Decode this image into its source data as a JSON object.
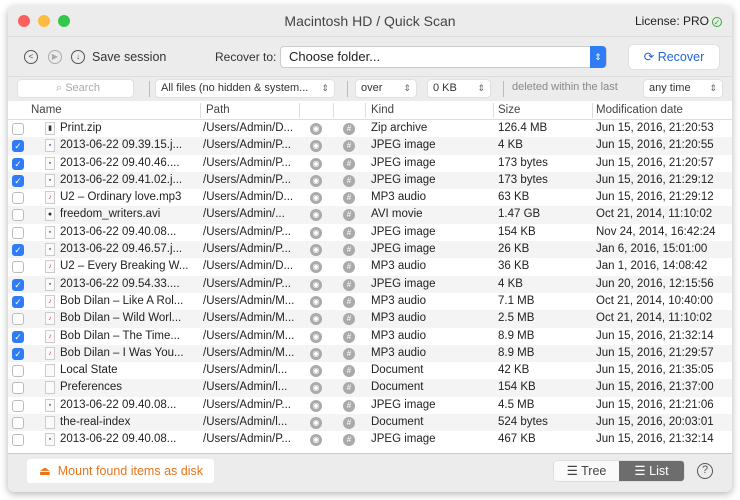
{
  "window": {
    "title": "Macintosh HD / Quick Scan",
    "license": "License: PRO",
    "traffic_colors": [
      "#fc605c",
      "#fdbc40",
      "#34c84a"
    ]
  },
  "toolbar": {
    "save_session": "Save session",
    "recover_to_label": "Recover to:",
    "recover_to_value": "Choose folder...",
    "recover_button": "Recover"
  },
  "filter": {
    "search_placeholder": "Search",
    "file_type": "All files (no hidden & system...",
    "size_op": "over",
    "size_value": "0 KB",
    "deleted_label": "deleted within the last",
    "time": "any time"
  },
  "columns": {
    "name": "Name",
    "path": "Path",
    "kind": "Kind",
    "size": "Size",
    "date": "Modification date"
  },
  "rows": [
    {
      "checked": false,
      "type": "zip",
      "name": "Print.zip",
      "path": "/Users/Admin/D...",
      "kind": "Zip archive",
      "size": "126.4 MB",
      "date": "Jun 15, 2016, 21:20:53"
    },
    {
      "checked": true,
      "type": "image",
      "name": "2013-06-22 09.39.15.j...",
      "path": "/Users/Admin/P...",
      "kind": "JPEG image",
      "size": "4 KB",
      "date": "Jun 15, 2016, 21:20:55"
    },
    {
      "checked": true,
      "type": "image",
      "name": "2013-06-22 09.40.46....",
      "path": "/Users/Admin/P...",
      "kind": "JPEG image",
      "size": "173 bytes",
      "date": "Jun 15, 2016, 21:20:57"
    },
    {
      "checked": true,
      "type": "image",
      "name": "2013-06-22 09.41.02.j...",
      "path": "/Users/Admin/P...",
      "kind": "JPEG image",
      "size": "173 bytes",
      "date": "Jun 15, 2016, 21:29:12"
    },
    {
      "checked": false,
      "type": "audio",
      "name": "U2 – Ordinary love.mp3",
      "path": "/Users/Admin/D...",
      "kind": "MP3 audio",
      "size": "63 KB",
      "date": "Jun 15, 2016, 21:29:12"
    },
    {
      "checked": false,
      "type": "video",
      "name": "freedom_writers.avi",
      "path": "/Users/Admin/...",
      "kind": "AVI movie",
      "size": "1.47 GB",
      "date": "Oct 21, 2014, 11:10:02"
    },
    {
      "checked": false,
      "type": "image",
      "name": "2013-06-22 09.40.08...",
      "path": "/Users/Admin/P...",
      "kind": "JPEG image",
      "size": "154 KB",
      "date": "Nov 24, 2014, 16:42:24"
    },
    {
      "checked": true,
      "type": "image",
      "name": "2013-06-22 09.46.57.j...",
      "path": "/Users/Admin/P...",
      "kind": "JPEG image",
      "size": "26 KB",
      "date": "Jan 6, 2016, 15:01:00"
    },
    {
      "checked": false,
      "type": "audio",
      "name": "U2 – Every Breaking W...",
      "path": "/Users/Admin/D...",
      "kind": "MP3 audio",
      "size": "36 KB",
      "date": "Jan 1, 2016, 14:08:42"
    },
    {
      "checked": true,
      "type": "image",
      "name": "2013-06-22 09.54.33....",
      "path": "/Users/Admin/P...",
      "kind": "JPEG image",
      "size": "4 KB",
      "date": "Jun 20, 2016, 12:15:56"
    },
    {
      "checked": true,
      "type": "audio",
      "name": "Bob Dilan – Like A Rol...",
      "path": "/Users/Admin/M...",
      "kind": "MP3 audio",
      "size": "7.1 MB",
      "date": "Oct 21, 2014, 10:40:00"
    },
    {
      "checked": false,
      "type": "audio",
      "name": "Bob Dilan – Wild Worl...",
      "path": "/Users/Admin/M...",
      "kind": "MP3 audio",
      "size": "2.5 MB",
      "date": "Oct 21, 2014, 11:10:02"
    },
    {
      "checked": true,
      "type": "audio",
      "name": "Bob Dilan – The Time...",
      "path": "/Users/Admin/M...",
      "kind": "MP3 audio",
      "size": "8.9 MB",
      "date": "Jun 15, 2016, 21:32:14"
    },
    {
      "checked": true,
      "type": "audio",
      "name": "Bob Dilan – I Was You...",
      "path": "/Users/Admin/M...",
      "kind": "MP3 audio",
      "size": "8.9 MB",
      "date": "Jun 15, 2016, 21:29:57"
    },
    {
      "checked": false,
      "type": "document",
      "name": "Local State",
      "path": "/Users/Admin/l...",
      "kind": "Document",
      "size": "42 KB",
      "date": "Jun 15, 2016, 21:35:05"
    },
    {
      "checked": false,
      "type": "document",
      "name": "Preferences",
      "path": "/Users/Admin/l...",
      "kind": "Document",
      "size": "154 KB",
      "date": "Jun 15, 2016, 21:37:00"
    },
    {
      "checked": false,
      "type": "image",
      "name": "2013-06-22 09.40.08...",
      "path": "/Users/Admin/P...",
      "kind": "JPEG image",
      "size": "4.5 MB",
      "date": "Jun 15, 2016, 21:21:06"
    },
    {
      "checked": false,
      "type": "document",
      "name": "the-real-index",
      "path": "/Users/Admin/l...",
      "kind": "Document",
      "size": "524 bytes",
      "date": "Jun 15, 2016, 20:03:01"
    },
    {
      "checked": false,
      "type": "image",
      "name": "2013-06-22 09.40.08...",
      "path": "/Users/Admin/P...",
      "kind": "JPEG image",
      "size": "467 KB",
      "date": "Jun 15, 2016, 21:32:14"
    }
  ],
  "bottom": {
    "mount": "Mount found items as disk",
    "tree": "Tree",
    "list": "List",
    "active_view": "list",
    "help": "?"
  },
  "colors": {
    "accent": "#2f7cf6",
    "mount": "#e8751a",
    "recover": "#2467d6"
  }
}
